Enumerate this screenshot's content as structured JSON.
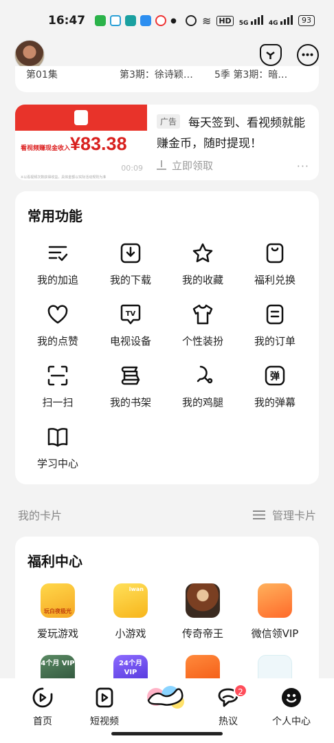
{
  "status_bar": {
    "time": "16:47",
    "network": "5G",
    "network2": "4G",
    "hd": "HD",
    "battery": "93"
  },
  "header": {
    "avatar": "avatar",
    "shield_icon": "shield-icon",
    "chat_icon": "chat-icon"
  },
  "partial_row": {
    "items": [
      "第01集",
      "第3期：徐诗颖…",
      "5季 第3期：暗…"
    ]
  },
  "ad": {
    "banner_label": "看视频赚现金收入",
    "amount": "¥83.38",
    "duration": "00:09",
    "fine_print": "※以看视频次数获得收益，具体金额以实际活动规则为准",
    "tag": "广告",
    "text": "每天签到、看视频就能赚金币，随时提现！",
    "cta": "立即领取",
    "more": "···"
  },
  "functions": {
    "title": "常用功能",
    "items": [
      {
        "label": "我的加追",
        "icon": "follow-list-icon"
      },
      {
        "label": "我的下载",
        "icon": "download-icon"
      },
      {
        "label": "我的收藏",
        "icon": "star-icon"
      },
      {
        "label": "福利兑换",
        "icon": "redeem-icon"
      },
      {
        "label": "我的点赞",
        "icon": "heart-icon"
      },
      {
        "label": "电视设备",
        "icon": "tv-icon"
      },
      {
        "label": "个性装扮",
        "icon": "tshirt-icon"
      },
      {
        "label": "我的订单",
        "icon": "order-icon"
      },
      {
        "label": "扫一扫",
        "icon": "scan-icon"
      },
      {
        "label": "我的书架",
        "icon": "bookshelf-icon"
      },
      {
        "label": "我的鸡腿",
        "icon": "drumstick-icon"
      },
      {
        "label": "我的弹幕",
        "icon": "danmaku-icon"
      },
      {
        "label": "学习中心",
        "icon": "book-icon"
      }
    ],
    "danmaku_glyph": "弹",
    "tv_glyph": "TV"
  },
  "cards": {
    "title": "我的卡片",
    "manage_label": "管理卡片"
  },
  "welfare": {
    "title": "福利中心",
    "apps": [
      {
        "label": "爱玩游戏",
        "tile_text": "玩白夜极光",
        "color": "#f7c42c"
      },
      {
        "label": "小游戏",
        "tile_text": "iwan",
        "color": "#f9c531"
      },
      {
        "label": "传奇帝王",
        "tile_text": "",
        "color": "#8b5a3a"
      },
      {
        "label": "微信领VIP",
        "tile_text": "",
        "color": "#ff8a3d"
      }
    ],
    "apps_row2": [
      {
        "tile_text": "4个月 VIP",
        "color": "#3d6b4a"
      },
      {
        "tile_text": "24个月 VIP",
        "color": "#6a4cf0"
      },
      {
        "tile_text": "",
        "color": "#ff6a20"
      },
      {
        "tile_text": "",
        "color": "#e6f3f8"
      }
    ]
  },
  "nav": {
    "items": [
      {
        "label": "首页",
        "icon": "play-home-icon"
      },
      {
        "label": "短视频",
        "icon": "short-video-icon"
      },
      {
        "label": "热议",
        "icon": "hot-discussion-icon",
        "badge": "2"
      },
      {
        "label": "个人中心",
        "icon": "profile-icon"
      }
    ],
    "center_logo": "center-logo"
  }
}
